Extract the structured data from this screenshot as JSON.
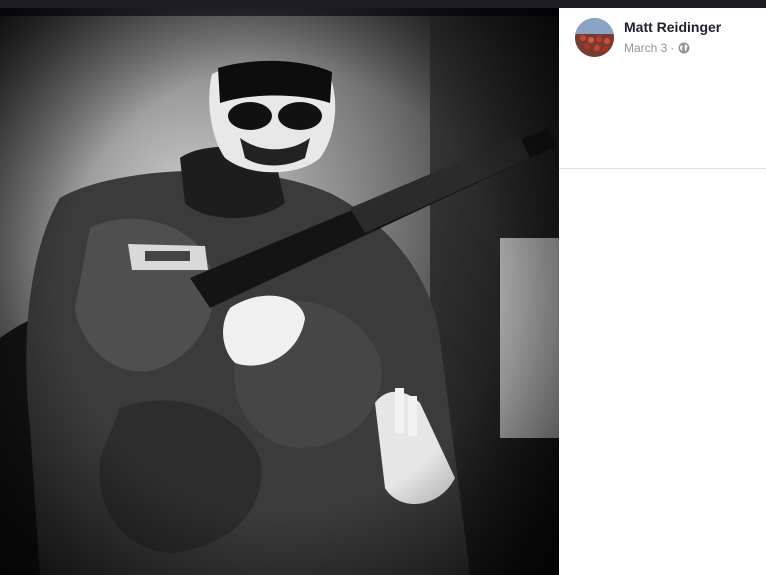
{
  "post": {
    "author_name": "Matt Reidinger",
    "date": "March 3",
    "separator": "·",
    "privacy_icon": "globe-icon"
  },
  "photo": {
    "description_icon": "post-photo"
  },
  "colors": {
    "name_text": "#1d2129",
    "meta_text": "#90949c",
    "divider": "#dddfe2",
    "top_bar": "#1c1e21"
  }
}
